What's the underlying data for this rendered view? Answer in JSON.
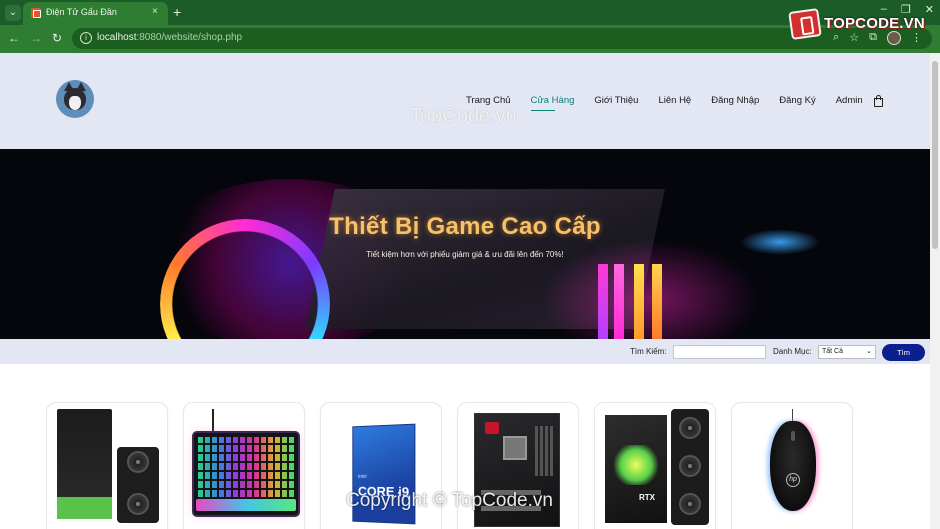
{
  "browser": {
    "tab_title": "Điện Tử Gấu Đần",
    "tab_close": "×",
    "new_tab": "+",
    "url_host": "localhost",
    "url_path": ":8080/website/shop.php",
    "nav_icons": [
      "back-arrow-icon",
      "forward-arrow-icon",
      "reload-icon"
    ],
    "window_controls": [
      "–",
      "❐",
      "✕"
    ]
  },
  "overlay_logo": {
    "text": "TOPCODE.VN",
    "brand_color": "#d32f2f"
  },
  "watermarks": {
    "top": "TopCode.vn",
    "bottom": "Copyright © TopCode.vn"
  },
  "site": {
    "nav": [
      {
        "label": "Trang Chủ",
        "active": false
      },
      {
        "label": "Cửa Hàng",
        "active": true
      },
      {
        "label": "Giới Thiệu",
        "active": false
      },
      {
        "label": "Liên Hệ",
        "active": false
      },
      {
        "label": "Đăng Nhập",
        "active": false
      },
      {
        "label": "Đăng Ký",
        "active": false
      },
      {
        "label": "Admin",
        "active": false
      }
    ],
    "accent_color": "#088178",
    "header_bg": "#e3e6f3"
  },
  "hero": {
    "title": "Thiết Bị Game Cao Cấp",
    "subtitle": "Tiết kiệm hơn với phiếu giảm giá & ưu đãi lên đến 70%!"
  },
  "search": {
    "label": "Tìm Kiếm:",
    "value": "",
    "category_label": "Danh Mục:",
    "category_selected": "Tất Cả",
    "button": "Tìm",
    "button_color": "#0b1f8f"
  },
  "products": [
    {
      "kind": "graphics-card"
    },
    {
      "kind": "rgb-keyboard"
    },
    {
      "kind": "intel-core-i9-processor",
      "box_text": "CORE i9"
    },
    {
      "kind": "motherboard"
    },
    {
      "kind": "rtx-graphics-card",
      "box_text": "RTX"
    },
    {
      "kind": "gaming-mouse"
    }
  ]
}
